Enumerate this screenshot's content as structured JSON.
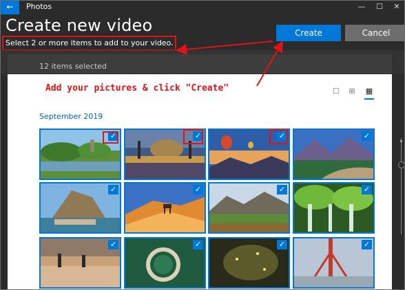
{
  "window": {
    "title": "Photos",
    "back_icon": "←",
    "minimize_icon": "—",
    "maximize_icon": "☐",
    "close_icon": "✕"
  },
  "header": {
    "title": "Create new video",
    "subtitle": "Select 2 or more items to add to your video.",
    "create_label": "Create",
    "cancel_label": "Cancel"
  },
  "selection": {
    "count_text": "12 items selected"
  },
  "annotation": {
    "text": "Add your pictures & click \"Create\""
  },
  "view_options": [
    "☐",
    "⊞",
    "▦"
  ],
  "group": {
    "label": "September 2019"
  },
  "photos": [
    {
      "name": "photo-river-park",
      "selected": true
    },
    {
      "name": "photo-castle-bridge",
      "selected": true
    },
    {
      "name": "photo-balloons-valley",
      "selected": true
    },
    {
      "name": "photo-mountain-lake",
      "selected": true
    },
    {
      "name": "photo-rock-village",
      "selected": true
    },
    {
      "name": "photo-desert-oryx",
      "selected": true
    },
    {
      "name": "photo-mountain-meadow",
      "selected": true
    },
    {
      "name": "photo-green-waterfall",
      "selected": true
    },
    {
      "name": "photo-beach-people",
      "selected": true
    },
    {
      "name": "photo-aerial-island",
      "selected": true
    },
    {
      "name": "photo-forest-fireflies",
      "selected": true
    },
    {
      "name": "photo-red-bridge",
      "selected": true
    }
  ],
  "colors": {
    "accent": "#0078d7",
    "highlight": "#e01414",
    "background": "#2b2b2b"
  }
}
